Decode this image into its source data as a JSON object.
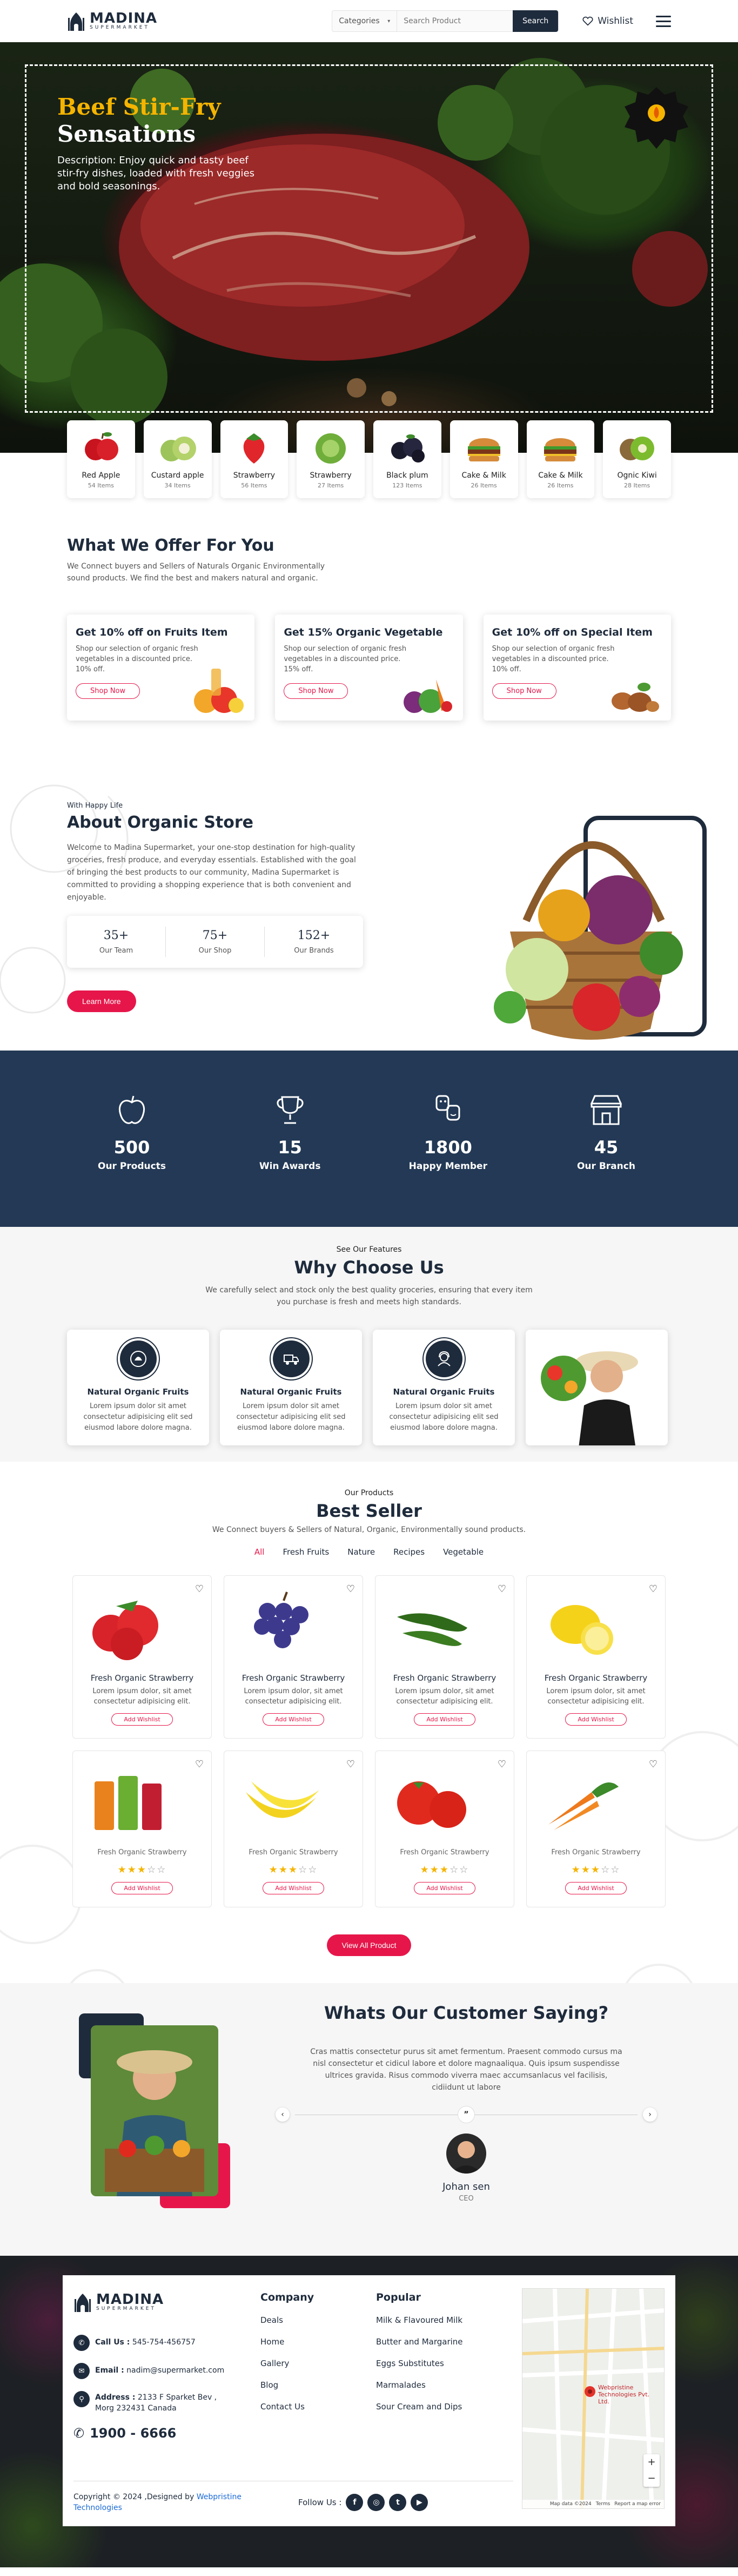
{
  "header": {
    "logo_name": "MADINA",
    "logo_sub": "SUPERMARKET",
    "category_label": "Categories",
    "search_placeholder": "Search Product",
    "search_button": "Search",
    "wishlist_label": "Wishlist"
  },
  "hero": {
    "title_line1": "Beef Stir-Fry",
    "title_line2": "Sensations",
    "description": "Description: Enjoy quick and tasty beef stir-fry dishes, loaded with fresh veggies and bold seasonings."
  },
  "categories": [
    {
      "name": "Red Apple",
      "count": "54 Items"
    },
    {
      "name": "Custard apple",
      "count": "34 Items"
    },
    {
      "name": "Strawberry",
      "count": "56 Items"
    },
    {
      "name": "Strawberry",
      "count": "27 Items"
    },
    {
      "name": "Black plum",
      "count": "123 Items"
    },
    {
      "name": "Cake & Milk",
      "count": "26 Items"
    },
    {
      "name": "Cake & Milk",
      "count": "26 Items"
    },
    {
      "name": "Ognic Kiwi",
      "count": "28 Items"
    }
  ],
  "offer": {
    "title": "What We Offer For You",
    "subtitle": "We Connect buyers and Sellers of Naturals Organic Environmentally sound products. We find the best and makers natural and organic.",
    "cards": [
      {
        "title": "Get 10% off on Fruits Item",
        "text": "Shop our selection of organic fresh vegetables in a discounted price. 10% off.",
        "button": "Shop Now"
      },
      {
        "title": "Get 15% Organic Vegetable",
        "text": "Shop our selection of organic fresh vegetables in a discounted price. 15% off.",
        "button": "Shop Now"
      },
      {
        "title": "Get 10% off on Special Item",
        "text": "Shop our selection of organic fresh vegetables in a discounted price. 10% off.",
        "button": "Shop Now"
      }
    ]
  },
  "about": {
    "kicker": "With Happy Life",
    "title": "About Organic Store",
    "text": "Welcome to Madina Supermarket, your one-stop destination for high-quality groceries, fresh produce, and everyday essentials. Established with the goal of bringing the best products to our community, Madina Supermarket is committed to providing a shopping experience that is both convenient and enjoyable.",
    "stats": [
      {
        "value": "35+",
        "label": "Our Team"
      },
      {
        "value": "75+",
        "label": "Our Shop"
      },
      {
        "value": "152+",
        "label": "Our Brands"
      }
    ],
    "button": "Learn More"
  },
  "counters": [
    {
      "value": "500",
      "label": "Our Products"
    },
    {
      "value": "15",
      "label": "Win Awards"
    },
    {
      "value": "1800",
      "label": "Happy Member"
    },
    {
      "value": "45",
      "label": "Our Branch"
    }
  ],
  "why": {
    "kicker": "See Our Features",
    "title": "Why Choose Us",
    "subtitle": "We carefully select and stock only the best quality groceries, ensuring that every item you purchase is fresh and meets high standards.",
    "cards": [
      {
        "title": "Natural Organic Fruits",
        "text": "Lorem ipsum dolor sit amet consectetur adipisicing elit sed eiusmod labore dolore magna."
      },
      {
        "title": "Natural Organic Fruits",
        "text": "Lorem ipsum dolor sit amet consectetur adipisicing elit sed eiusmod labore dolore magna."
      },
      {
        "title": "Natural Organic Fruits",
        "text": "Lorem ipsum dolor sit amet consectetur adipisicing elit sed eiusmod labore dolore magna."
      }
    ]
  },
  "best": {
    "kicker": "Our Products",
    "title": "Best Seller",
    "subtitle": "We Connect buyers & Sellers of Natural, Organic, Environmentally sound products.",
    "filters": [
      "All",
      "Fresh Fruits",
      "Nature",
      "Recipes",
      "Vegetable"
    ],
    "products_top": [
      {
        "name": "Fresh Organic Strawberry",
        "desc": "Lorem ipsum dolor, sit amet consectetur adipisicing elit.",
        "button": "Add Wishlist"
      },
      {
        "name": "Fresh Organic Strawberry",
        "desc": "Lorem ipsum dolor, sit amet consectetur adipisicing elit.",
        "button": "Add Wishlist"
      },
      {
        "name": "Fresh Organic Strawberry",
        "desc": "Lorem ipsum dolor, sit amet consectetur adipisicing elit.",
        "button": "Add Wishlist"
      },
      {
        "name": "Fresh Organic Strawberry",
        "desc": "Lorem ipsum dolor, sit amet consectetur adipisicing elit.",
        "button": "Add Wishlist"
      }
    ],
    "products_bottom": [
      {
        "name": "Fresh Organic Strawberry",
        "rating": 3,
        "button": "Add Wishlist"
      },
      {
        "name": "Fresh Organic Strawberry",
        "rating": 3,
        "button": "Add Wishlist"
      },
      {
        "name": "Fresh Organic Strawberry",
        "rating": 3,
        "button": "Add Wishlist"
      },
      {
        "name": "Fresh Organic Strawberry",
        "rating": 3,
        "button": "Add Wishlist"
      }
    ],
    "view_all": "View All Product"
  },
  "testimonial": {
    "title": "Whats Our Customer Saying?",
    "quote": "Cras mattis consectetur purus sit amet fermentum. Praesent commodo cursus ma nisl consectetur et cidicul labore et dolore magnaaliqua. Quis ipsum suspendisse ultrices gravida. Risus commodo viverra maec accumsanlacus vel facilisis, cidiidunt ut labore",
    "name": "Johan sen",
    "role": "CEO"
  },
  "footer": {
    "logo_name": "MADINA",
    "logo_sub": "SUPERMARKET",
    "call_label": "Call Us :",
    "call_value": "545-754-456757",
    "email_label": "Email :",
    "email_value": "nadim@supermarket.com",
    "address_label": "Address :",
    "address_value": "2133 F Sparket Bev , Morg 232431 Canada",
    "phone_big": "1900 - 6666",
    "company_title": "Company",
    "company_links": [
      "Deals",
      "Home",
      "Gallery",
      "Blog",
      "Contact Us"
    ],
    "popular_title": "Popular",
    "popular_links": [
      "Milk & Flavoured Milk",
      "Butter and Margarine",
      "Eggs Substitutes",
      "Marmalades",
      "Sour Cream and Dips"
    ],
    "copyright_prefix": "Copyright © 2024 ,Designed by",
    "copyright_link": "Webpristine Technologies",
    "follow_label": "Follow Us :",
    "map_label": "Webpristine Technologies Pvt. Ltd.",
    "map_credit": "Map data ©2024",
    "map_terms": "Terms",
    "map_report": "Report a map error"
  },
  "colors": {
    "navy": "#1e2b3c",
    "accent": "#e6164a",
    "gold": "#f5b400",
    "counter_bg": "#233955"
  }
}
